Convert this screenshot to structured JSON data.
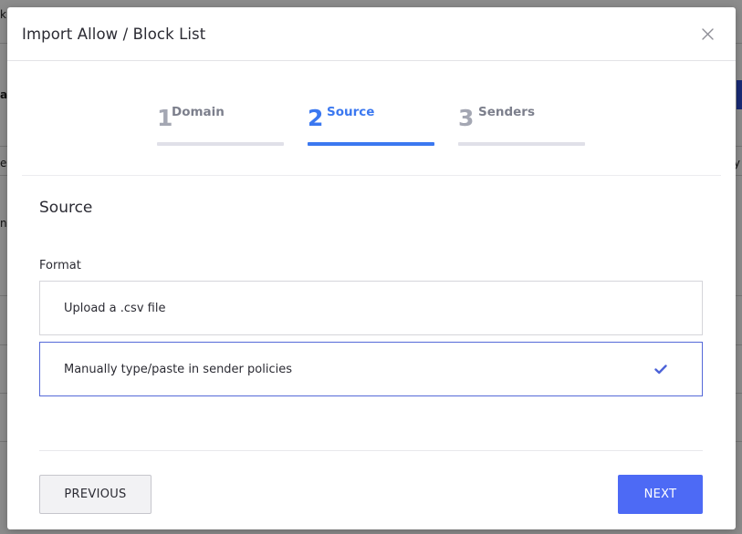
{
  "modal": {
    "title": "Import Allow / Block List",
    "close_icon": "close-icon"
  },
  "stepper": {
    "steps": [
      {
        "number": "1",
        "label": "Domain",
        "active": false
      },
      {
        "number": "2",
        "label": "Source",
        "active": true
      },
      {
        "number": "3",
        "label": "Senders",
        "active": false
      }
    ]
  },
  "source": {
    "title": "Source",
    "format_label": "Format",
    "options": [
      {
        "label": "Upload a .csv file",
        "selected": false
      },
      {
        "label": "Manually type/paste in sender policies",
        "selected": true,
        "icon": "checkmark-icon"
      }
    ]
  },
  "footer": {
    "previous_label": "PREVIOUS",
    "next_label": "NEXT"
  },
  "background": {
    "fragments": [
      "k",
      "a",
      "e",
      "ng",
      "y"
    ]
  },
  "colors": {
    "accent": "#3b78f0",
    "primary_button": "#4d6af5",
    "selected_border": "#5569d8"
  }
}
